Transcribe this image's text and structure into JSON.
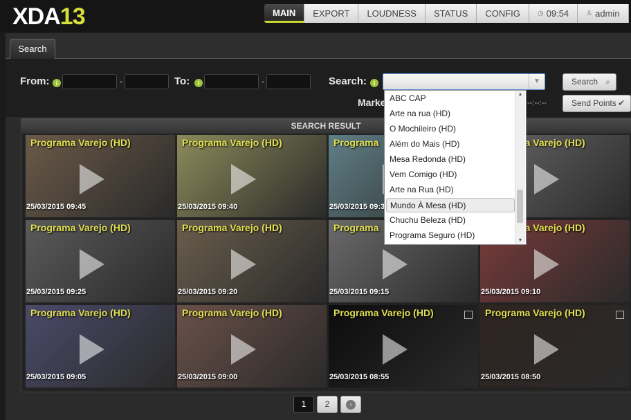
{
  "app": {
    "logo_text": "XDA",
    "logo_number": "13"
  },
  "nav": {
    "tabs": [
      {
        "label": "MAIN",
        "active": true
      },
      {
        "label": "EXPORT"
      },
      {
        "label": "LOUDNESS"
      },
      {
        "label": "STATUS"
      },
      {
        "label": "CONFIG"
      }
    ],
    "time": "09:54",
    "user": "admin"
  },
  "subtab": {
    "label": "Search"
  },
  "form": {
    "from_label": "From:",
    "to_label": "To:",
    "search_label": "Search:",
    "marker_label": "Marke",
    "marker_time": "--:--:--",
    "date_sep": "-",
    "search_button": "Search",
    "send_points_button": "Send Points",
    "search_value": ""
  },
  "dropdown": {
    "options": [
      "ABC CAP",
      "Arte na rua (HD)",
      "O Mochileiro (HD)",
      "Além do Mais (HD)",
      "Mesa Redonda (HD)",
      "Vem Comigo (HD)",
      "Arte na Rua (HD)",
      "Mundo À Mesa (HD)",
      "Chuchu Beleza (HD)",
      "Programa Seguro (HD)"
    ],
    "highlighted": "Mundo À Mesa (HD)"
  },
  "results": {
    "header": "SEARCH RESULT",
    "items": [
      {
        "title": "Programa Varejo (HD)",
        "time": "25/03/2015 09:45",
        "color": "#6b5a48"
      },
      {
        "title": "Programa Varejo (HD)",
        "time": "25/03/2015 09:40",
        "color": "#8c8a5a"
      },
      {
        "title": "Programa",
        "time": "25/03/2015 09:3",
        "color": "#5f7f86"
      },
      {
        "title": "Programa Varejo (HD)",
        "time": "30",
        "color": "#666"
      },
      {
        "title": "Programa Varejo (HD)",
        "time": "25/03/2015 09:25",
        "color": "#5a5a5a"
      },
      {
        "title": "Programa Varejo (HD)",
        "time": "25/03/2015 09:20",
        "color": "#6a5e4c"
      },
      {
        "title": "Programa",
        "time": "25/03/2015 09:15",
        "color": "#6a6a6a"
      },
      {
        "title": "Programa Varejo (HD)",
        "time": "25/03/2015 09:10",
        "color": "#7a3a3a"
      },
      {
        "title": "Programa Varejo (HD)",
        "time": "25/03/2015 09:05",
        "color": "#4a4a6a"
      },
      {
        "title": "Programa Varejo (HD)",
        "time": "25/03/2015 09:00",
        "color": "#6a5048"
      },
      {
        "title": "Programa Varejo (HD)",
        "time": "25/03/2015 08:55",
        "color": "#0c0c0c"
      },
      {
        "title": "Programa Varejo (HD)",
        "time": "25/03/2015 08:50",
        "color": "#2e2420"
      }
    ]
  },
  "pager": {
    "pages": [
      "1",
      "2"
    ],
    "next": "›"
  },
  "colors": {
    "accent": "#c9d534",
    "title_yellow": "#e1e052"
  }
}
